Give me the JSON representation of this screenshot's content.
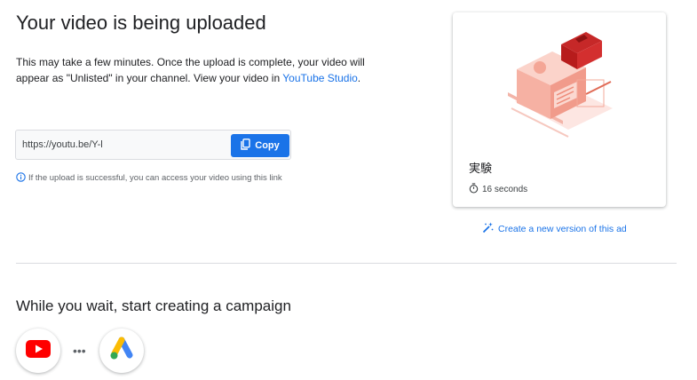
{
  "header": {
    "title": "Your video is being uploaded",
    "desc_text": "This may take a few minutes. Once the upload is complete, your video will appear as \"Unlisted\" in your channel. View your video in ",
    "desc_link": "YouTube Studio",
    "desc_end": "."
  },
  "share": {
    "url": "https://youtu.be/Y-l",
    "copy_label": "Copy",
    "info_text": "If the upload is successful, you can access your video using this link"
  },
  "video_card": {
    "title": "実験",
    "duration": "16 seconds"
  },
  "create_link": "Create a new version of this ad",
  "campaign": {
    "heading": "While you wait, start creating a campaign",
    "dots": "•••"
  },
  "colors": {
    "accent": "#1a73e8",
    "youtube_red": "#ff0000"
  }
}
